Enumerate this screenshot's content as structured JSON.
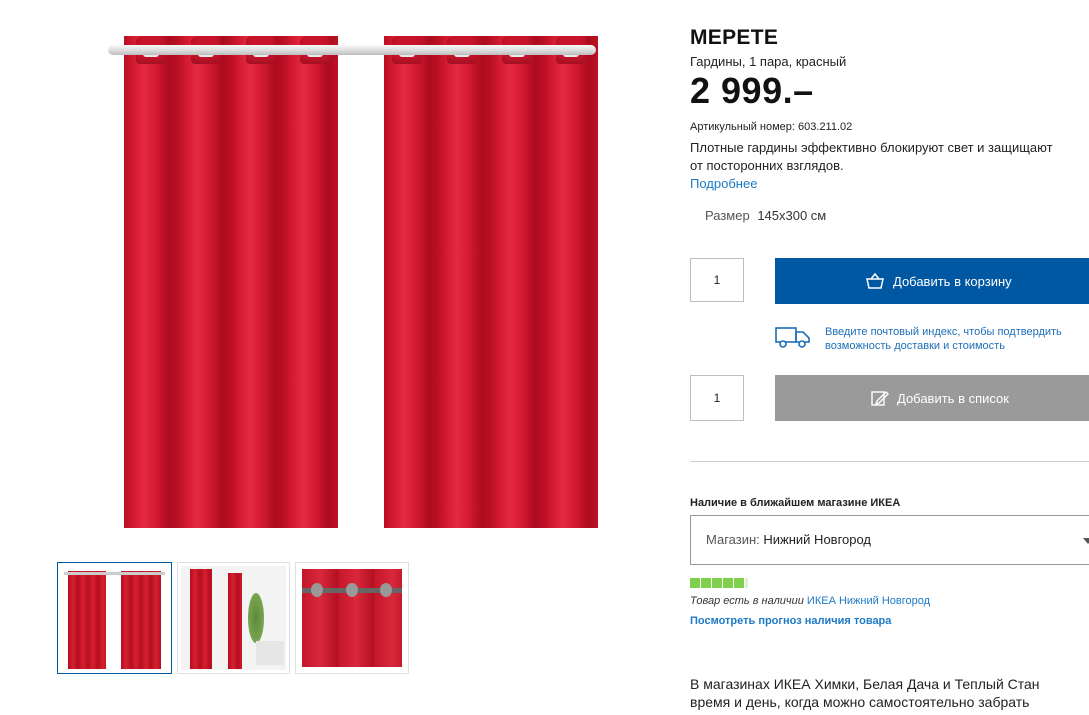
{
  "product": {
    "name": "МЕРЕТЕ",
    "description": "Гардины, 1 пара, красный",
    "price": "2 999.–",
    "article_label": "Артикульный номер:",
    "article_number": "603.211.02",
    "text_line1": "Плотные гардины эффективно блокируют свет и защищают",
    "text_line2": "от посторонних взглядов.",
    "more_link": "Подробнее",
    "size_label": "Размер",
    "size_value": "145x300 см"
  },
  "cart": {
    "quantity": "1",
    "button_label": "Добавить в корзину",
    "button_color": "#0058a3"
  },
  "delivery": {
    "line1": "Введите почтовый индекс, чтобы подтвердить",
    "line2": "возможность доставки и стоимость"
  },
  "wishlist": {
    "quantity": "1",
    "button_label": "Добавить в список",
    "button_color": "#9a9a9a"
  },
  "availability": {
    "title": "Наличие в ближайшем магазине ИКЕА",
    "store_label": "Магазин:",
    "store_value": "Нижний Новгород",
    "stock_level": 1.0,
    "stock_color": "#7fd04d",
    "note_prefix": "Товар есть в наличии",
    "note_store": "ИКЕА Нижний Новгород",
    "forecast_link": "Посмотреть прогноз наличия товара"
  },
  "pickup": {
    "line1": "В магазинах ИКЕА Химки, Белая Дача и Теплый Стан",
    "line2": "время и день, когда можно самостоятельно забрать"
  },
  "gallery": {
    "thumbnails": [
      "curtains-front",
      "curtains-room",
      "curtains-rings-closeup"
    ],
    "active_index": 0
  }
}
